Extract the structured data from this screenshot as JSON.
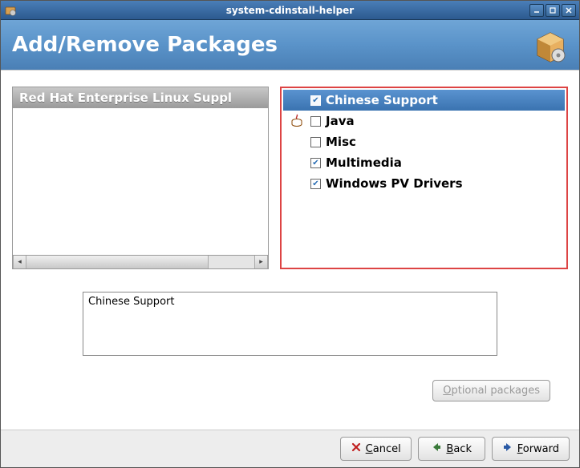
{
  "window": {
    "title": "system-cdinstall-helper"
  },
  "header": {
    "title": "Add/Remove Packages"
  },
  "categories": {
    "header": "Red Hat Enterprise Linux Suppl"
  },
  "packages": [
    {
      "label": "Chinese Support",
      "checked": true,
      "selected": true,
      "icon": null
    },
    {
      "label": "Java",
      "checked": false,
      "selected": false,
      "icon": "java"
    },
    {
      "label": "Misc",
      "checked": false,
      "selected": false,
      "icon": null
    },
    {
      "label": "Multimedia",
      "checked": true,
      "selected": false,
      "icon": null
    },
    {
      "label": "Windows PV Drivers",
      "checked": true,
      "selected": false,
      "icon": null
    }
  ],
  "description": "Chinese Support",
  "buttons": {
    "optional": "Optional packages",
    "cancel": "Cancel",
    "back": "Back",
    "forward": "Forward"
  }
}
